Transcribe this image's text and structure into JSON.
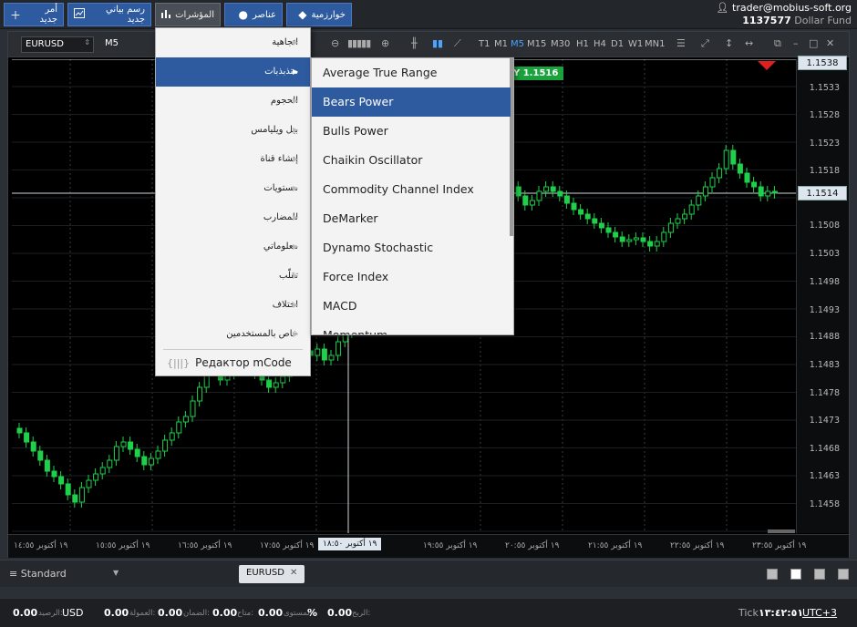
{
  "toolbar": {
    "new_order": "أمر جديد",
    "new_chart": "رسم بياني جديد",
    "indicators": "المؤشرات",
    "elements": "عناصر",
    "algorithms": "خوارزمية"
  },
  "account": {
    "user": "trader@mobius-soft.org",
    "number": "1137577",
    "fund": "Dollar Fund"
  },
  "chart": {
    "symbol": "EURUSD",
    "timeframe": "M5",
    "timeframes": [
      "T1",
      "M1",
      "M5",
      "M15",
      "M30",
      "H1",
      "H4",
      "D1",
      "W1",
      "MN1"
    ],
    "active_timeframe": "M5",
    "bid_tag": "Y 1.1516",
    "price_tag_top": "1.1538",
    "price_tag_cur": "1.1514",
    "time_tag": "١٩ أكتوبر ١٨:٥٠",
    "price_labels": [
      "1.1533",
      "1.1528",
      "1.1523",
      "1.1518",
      "1.1508",
      "1.1503",
      "1.1498",
      "1.1493",
      "1.1488",
      "1.1483",
      "1.1478",
      "1.1473",
      "1.1468",
      "1.1463",
      "1.1458"
    ],
    "time_labels": [
      "١٩ أكتوبر ١٤:٥٥",
      "١٩ أكتوبر ١٥:٥٥",
      "١٩ أكتوبر ١٦:٥٥",
      "١٩ أكتوبر ١٧:٥٥",
      "١٩ أكتوبر ١٩:٥٥",
      "١٩ أكتوبر ٢٠:٥٥",
      "١٩ أكتوبر ٢١:٥٥",
      "١٩ أكتوبر ٢٢:٥٥",
      "١٩ أكتوبر ٢٣:٥٥"
    ],
    "colors": {
      "bull": "#1fd14a",
      "bear": "#1fd14a",
      "grid": "#1c1f22",
      "bg": "#000000"
    }
  },
  "indicators_menu": {
    "items": [
      "اتجاهية",
      "متذبذبات",
      "الحجوم",
      "بيل ويليامس",
      "إنشاء قناة",
      "مستويات",
      "للمضارب",
      "معلوماتي",
      "تقلّب",
      "اختلاف",
      "خاص بالمستخدمين"
    ],
    "selected": "متذبذبات",
    "code_editor": "Редактор mCode"
  },
  "oscillators_menu": {
    "items": [
      "Average True Range",
      "Bears Power",
      "Bulls Power",
      "Chaikin Oscillator",
      "Commodity Channel Index",
      "DeMarker",
      "Dynamo Stochastic",
      "Force Index",
      "MACD",
      "Momentum"
    ],
    "selected": "Bears Power"
  },
  "tabbar": {
    "workspace": "Standard",
    "chart_tab": "EURUSD"
  },
  "status": {
    "balance_val": "0.00",
    "balance_lbl": "الرصيد:",
    "currency": "USD",
    "commission_val": "0.00",
    "commission_lbl": "العمولة:",
    "margin_val": "0.00",
    "margin_lbl": "الضمان:",
    "free_val": "0.00",
    "free_lbl": "متاح:",
    "level_val": "%",
    "level_lbl": "المستوى:",
    "profit_val": "0.00",
    "profit_lbl": "الربح:",
    "tick_lbl": "Tick",
    "tick_time": "١٣:٤٢:٥١",
    "tz": "UTC+3"
  }
}
